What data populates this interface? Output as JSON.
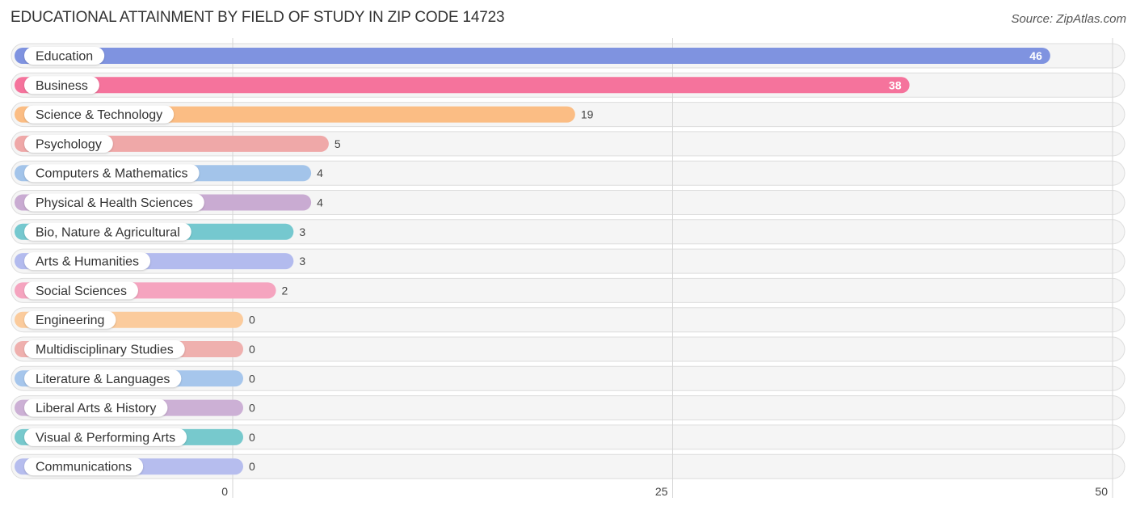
{
  "chart_data": {
    "type": "bar",
    "orientation": "horizontal",
    "title": "EDUCATIONAL ATTAINMENT BY FIELD OF STUDY IN ZIP CODE 14723",
    "source": "Source: ZipAtlas.com",
    "xlabel": "",
    "ylabel": "",
    "xlim": [
      0,
      50
    ],
    "ticks": [
      0,
      25,
      50
    ],
    "tick_labels": [
      "0",
      "25",
      "50"
    ],
    "grid": true,
    "categories": [
      "Education",
      "Business",
      "Science & Technology",
      "Psychology",
      "Computers & Mathematics",
      "Physical & Health Sciences",
      "Bio, Nature & Agricultural",
      "Arts & Humanities",
      "Social Sciences",
      "Engineering",
      "Multidisciplinary Studies",
      "Literature & Languages",
      "Liberal Arts & History",
      "Visual & Performing Arts",
      "Communications"
    ],
    "values": [
      46,
      38,
      19,
      5,
      4,
      4,
      3,
      3,
      2,
      0,
      0,
      0,
      0,
      0,
      0
    ],
    "value_labels": [
      "46",
      "38",
      "19",
      "5",
      "4",
      "4",
      "3",
      "3",
      "2",
      "0",
      "0",
      "0",
      "0",
      "0",
      "0"
    ],
    "colors": [
      "#7f93e0",
      "#f5739c",
      "#fbbd84",
      "#efa8a8",
      "#a3c4ea",
      "#c9abd2",
      "#75c8cf",
      "#b3bbee",
      "#f5a4bf",
      "#fbcb9c",
      "#efb0ae",
      "#a6c6ec",
      "#ccb0d5",
      "#77c9cd",
      "#b6bdee"
    ]
  }
}
